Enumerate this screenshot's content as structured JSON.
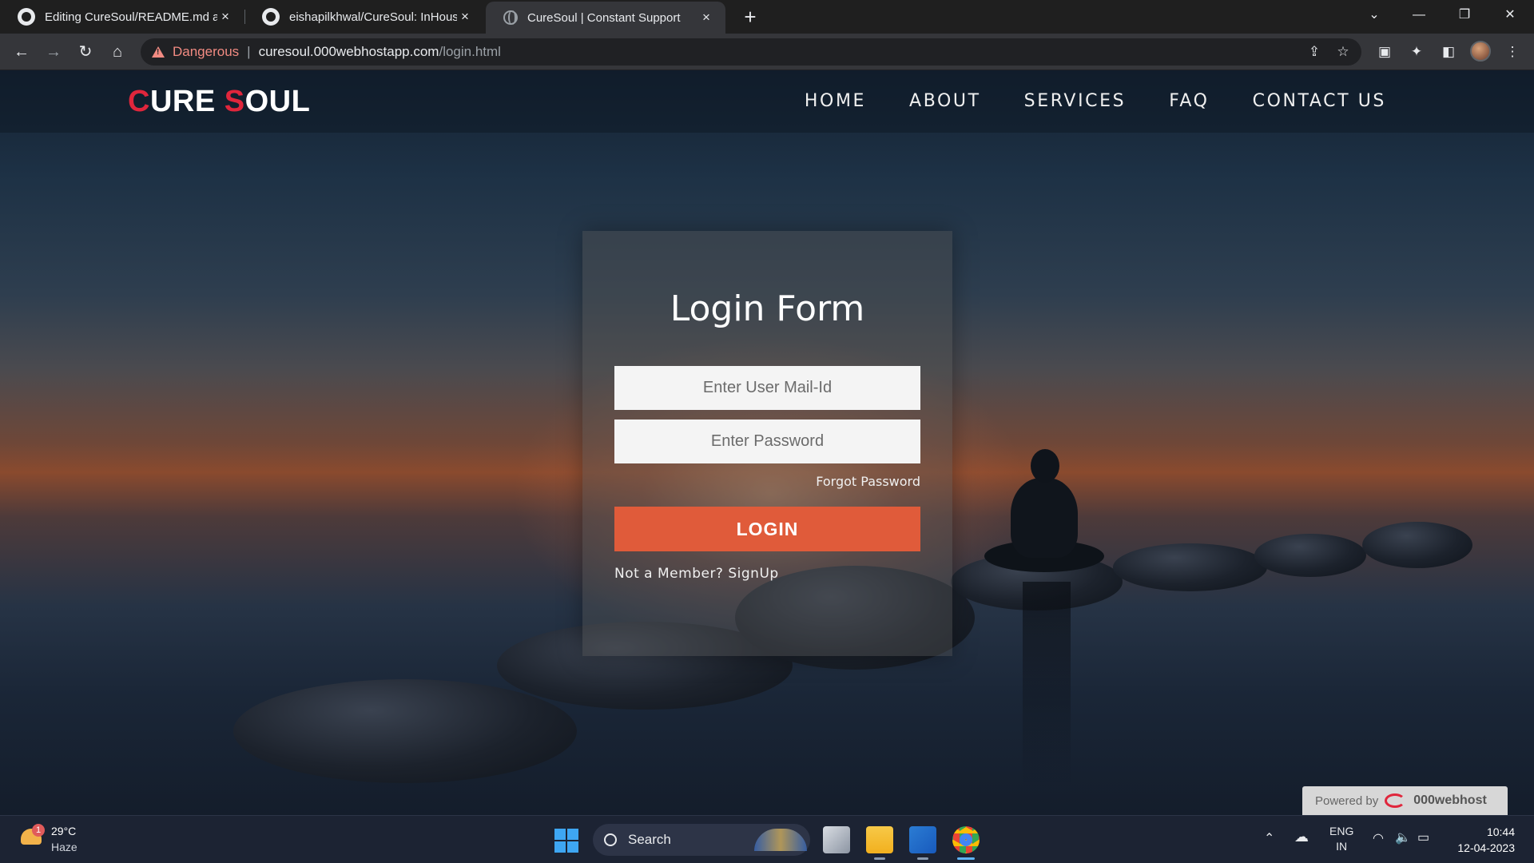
{
  "browser": {
    "tabs": [
      {
        "title": "Editing CureSoul/README.md at",
        "icon": "github-icon",
        "active": false
      },
      {
        "title": "eishapilkhwal/CureSoul: InHouse",
        "icon": "github-icon",
        "active": false
      },
      {
        "title": "CureSoul | Constant Support",
        "icon": "globe-icon",
        "active": true
      }
    ],
    "new_tab_label": "+",
    "close_glyph": "×",
    "security_label": "Dangerous",
    "url_host": "curesoul.000webhostapp.com",
    "url_path": "/login.html",
    "url_separator": "|"
  },
  "site": {
    "logo": {
      "c": "C",
      "ure": "URE ",
      "s": "S",
      "oul": "OUL"
    },
    "logo_accent": "#e0263c",
    "nav": [
      "HOME",
      "ABOUT",
      "SERVICES",
      "FAQ",
      "CONTACT US"
    ]
  },
  "login": {
    "title": "Login Form",
    "email_placeholder": "Enter User Mail-Id",
    "password_placeholder": "Enter Password",
    "forgot_label": "Forgot Password",
    "button_label": "LOGIN",
    "button_color": "#e05b3a",
    "signup_label": "Not a Member? SignUp"
  },
  "powered": {
    "prefix": "Powered by",
    "brand": "000webhost"
  },
  "taskbar": {
    "weather_badge": "1",
    "temperature": "29°C",
    "condition": "Haze",
    "search_label": "Search",
    "language_top": "ENG",
    "language_bottom": "IN",
    "time": "10:44",
    "date": "12-04-2023"
  }
}
